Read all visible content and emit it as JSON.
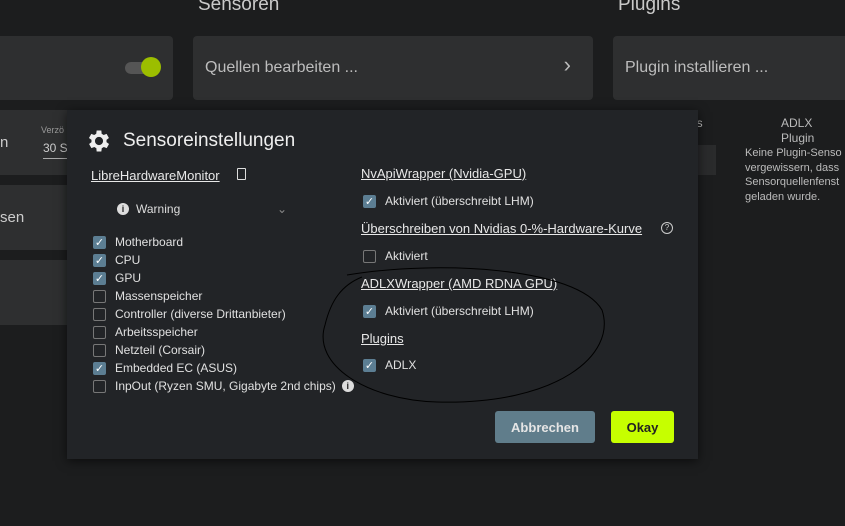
{
  "background": {
    "sensoren_title": "Sensoren",
    "plugins_title": "Plugins",
    "sources_card": "Quellen bearbeiten ...",
    "plugin_card": "Plugin installieren ...",
    "left_card1_text": "n",
    "delay_label": "Verzö",
    "delay_value": "30 S",
    "left_card2_text": "sen",
    "plugins_tab": "ns",
    "adlx_plugin_title": "ADLX Plugin",
    "adlx_info_lines": [
      "Keine Plugin-Senso",
      "vergewissern, dass",
      "Sensorquellenfenst",
      "geladen wurde."
    ]
  },
  "dialog": {
    "title": "Sensoreinstellungen",
    "lhm": {
      "title": "LibreHardwareMonitor",
      "log_level": "Warning",
      "items": [
        {
          "label": "Motherboard",
          "checked": true
        },
        {
          "label": "CPU",
          "checked": true
        },
        {
          "label": "GPU",
          "checked": true
        },
        {
          "label": "Massenspeicher",
          "checked": false
        },
        {
          "label": "Controller (diverse Drittanbieter)",
          "checked": false
        },
        {
          "label": "Arbeitsspeicher",
          "checked": false
        },
        {
          "label": "Netzteil (Corsair)",
          "checked": false
        },
        {
          "label": "Embedded EC (ASUS)",
          "checked": true
        },
        {
          "label": "InpOut (Ryzen SMU, Gigabyte 2nd chips)",
          "checked": false
        }
      ]
    },
    "nvapi": {
      "title": "NvApiWrapper (Nvidia-GPU)",
      "option": "Aktiviert (überschreibt LHM)",
      "checked": true
    },
    "nvcurve": {
      "title": "Überschreiben von Nvidias 0-%-Hardware-Kurve",
      "option": "Aktiviert",
      "checked": false
    },
    "adlx": {
      "title": "ADLXWrapper (AMD RDNA GPU)",
      "option": "Aktiviert (überschreibt LHM)",
      "checked": true
    },
    "plugins": {
      "title": "Plugins",
      "option": "ADLX",
      "checked": true
    },
    "cancel": "Abbrechen",
    "ok": "Okay"
  },
  "colors": {
    "accent": "#c6ff00",
    "cancel": "#607d8b",
    "checkbox": "#5c7e93"
  }
}
